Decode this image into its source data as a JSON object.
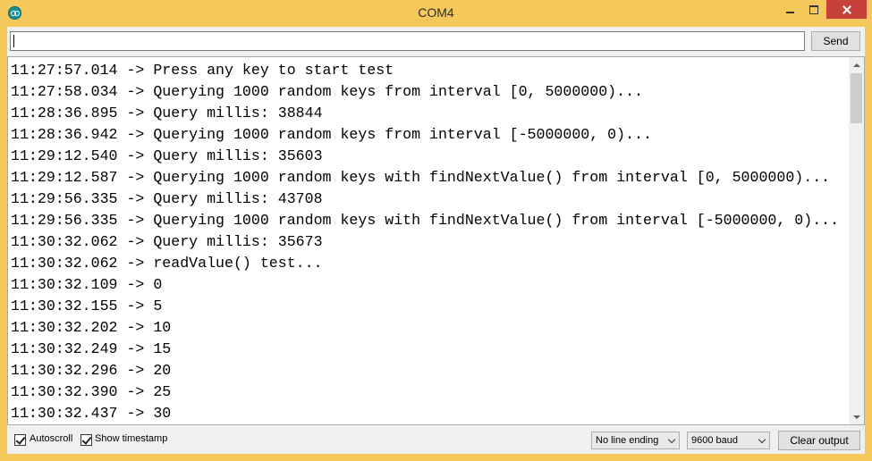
{
  "window": {
    "title": "COM4"
  },
  "input": {
    "value": "",
    "send_label": "Send"
  },
  "output": {
    "lines": [
      "11:27:57.014 -> Press any key to start test",
      "11:27:58.034 -> Querying 1000 random keys from interval [0, 5000000)...",
      "11:28:36.895 -> Query millis: 38844",
      "11:28:36.942 -> Querying 1000 random keys from interval [-5000000, 0)...",
      "11:29:12.540 -> Query millis: 35603",
      "11:29:12.587 -> Querying 1000 random keys with findNextValue() from interval [0, 5000000)...",
      "11:29:56.335 -> Query millis: 43708",
      "11:29:56.335 -> Querying 1000 random keys with findNextValue() from interval [-5000000, 0)...",
      "11:30:32.062 -> Query millis: 35673",
      "11:30:32.062 -> readValue() test...",
      "11:30:32.109 -> 0",
      "11:30:32.155 -> 5",
      "11:30:32.202 -> 10",
      "11:30:32.249 -> 15",
      "11:30:32.296 -> 20",
      "11:30:32.390 -> 25",
      "11:30:32.437 -> 30"
    ]
  },
  "bottom": {
    "autoscroll_label": "Autoscroll",
    "autoscroll_checked": true,
    "timestamp_label": "Show timestamp",
    "timestamp_checked": true,
    "line_ending": "No line ending",
    "baud": "9600 baud",
    "clear_label": "Clear output"
  },
  "icons": {
    "app": "arduino-icon",
    "minimize": "minimize-icon",
    "maximize": "maximize-icon",
    "close": "close-icon"
  },
  "colors": {
    "titlebar": "#f5c85c",
    "close_button": "#c7413a",
    "app_icon": "#1a8f93"
  }
}
